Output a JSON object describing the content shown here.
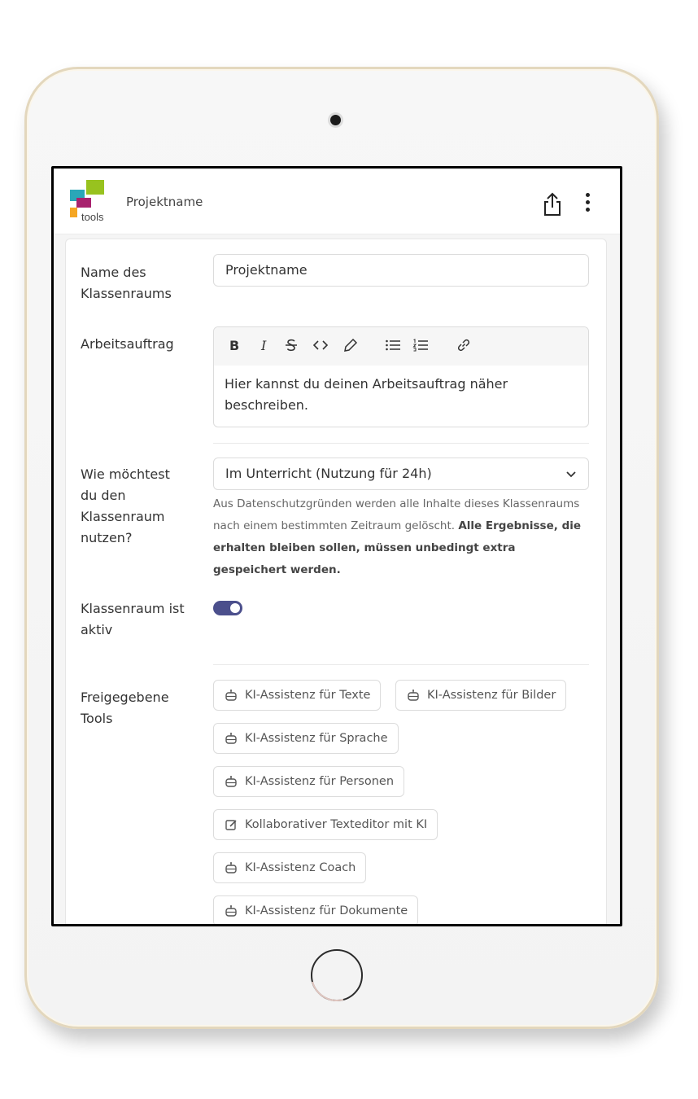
{
  "app": {
    "title": "Projektname",
    "logo_text": "tools",
    "brand_colors": [
      "#98c21f",
      "#2aa7b8",
      "#a8226e",
      "#f5a623"
    ]
  },
  "form": {
    "name_label": "Name des Klassenraums",
    "name_value": "Projektname",
    "task_label": "Arbeitsauftrag",
    "task_text": "Hier kannst du deinen Arbeitsauftrag näher beschreiben.",
    "toolbar": [
      "bold",
      "italic",
      "strikethrough",
      "code",
      "highlight",
      "bullet-list",
      "ordered-list",
      "link"
    ],
    "usage_label": "Wie möchtest du den Klassenraum nutzen?",
    "usage_value": "Im Unterricht (Nutzung für 24h)",
    "usage_help_plain": "Aus Datenschutzgründen werden alle Inhalte dieses Klassenraums nach einem bestimmten Zeitraum gelöscht.",
    "usage_help_bold": "Alle Ergebnisse, die erhalten bleiben sollen, müssen unbedingt extra gespeichert werden.",
    "active_label": "Klassenraum ist aktiv",
    "active_on": true,
    "tools_label": "Freigegebene Tools",
    "tools": [
      "KI-Assistenz für Texte",
      "KI-Assistenz für Bilder",
      "KI-Assistenz für Sprache",
      "KI-Assistenz für Personen",
      "Kollaborativer Texteditor mit KI",
      "KI-Assistenz Coach",
      "KI-Assistenz für Dokumente"
    ]
  },
  "colors": {
    "toggle": "#4b4f8c"
  }
}
